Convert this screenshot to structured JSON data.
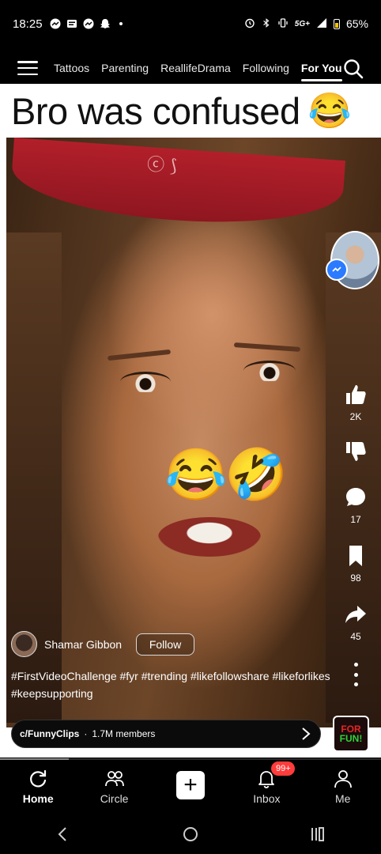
{
  "status_bar": {
    "time": "18:25",
    "battery": "65%",
    "network": "5G+",
    "notification_icons": [
      "messenger-icon",
      "news-icon",
      "messenger-icon",
      "snapchat-icon"
    ],
    "system_icons": [
      "alarm-icon",
      "bluetooth-icon",
      "vibrate-icon",
      "signal-icon",
      "battery-icon"
    ]
  },
  "top_nav": {
    "tabs": [
      {
        "label": "Tattoos"
      },
      {
        "label": "Parenting"
      },
      {
        "label": "ReallifeDrama"
      },
      {
        "label": "Following"
      },
      {
        "label": "For You"
      }
    ],
    "active_tab": "For You"
  },
  "video": {
    "caption": "Bro was confused",
    "caption_emoji": "😂",
    "overlay_emojis": [
      "😂",
      "🤣"
    ],
    "bandana_text": "ⓒ ⟆",
    "author": "Shamar Gibbon",
    "follow_label": "Follow",
    "hashtags_line1": "#FirstVideoChallenge #fyr #trending #likefollowshare #likeforlikes",
    "hashtags_line2": "#keepsupporting"
  },
  "rail": {
    "likes": "2K",
    "comments": "17",
    "saves": "98",
    "shares": "45"
  },
  "community": {
    "name": "c/FunnyClips",
    "members": "1.7M members",
    "separator": "·",
    "badge_line1": "FOR",
    "badge_line2": "FUN!"
  },
  "bottom_tabs": {
    "home": "Home",
    "circle": "Circle",
    "create": "+",
    "inbox": "Inbox",
    "inbox_badge": "99+",
    "me": "Me"
  },
  "colors": {
    "accent_red": "#ff3b3b",
    "messenger_blue": "#2a7bff",
    "background": "#000000"
  }
}
